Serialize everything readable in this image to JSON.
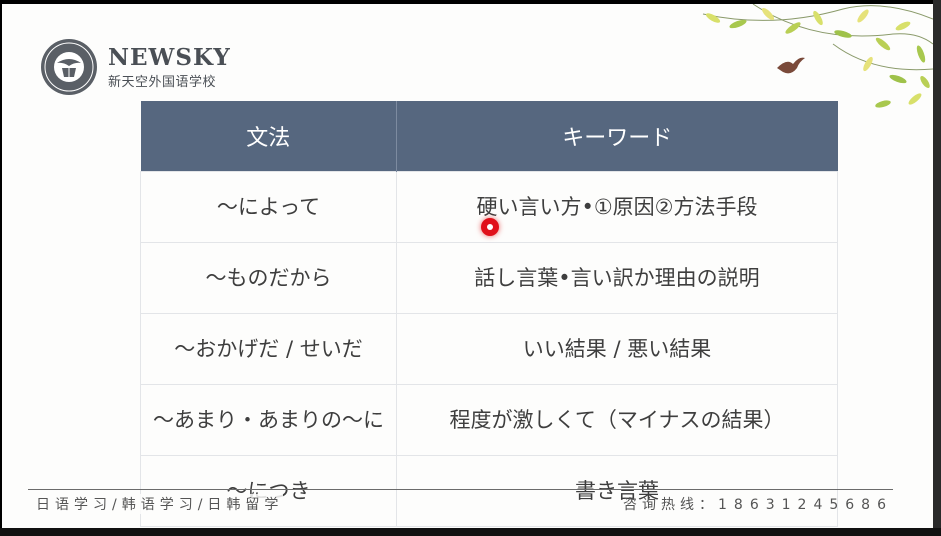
{
  "brand": {
    "name": "NEWSKY",
    "subtitle": "新天空外国语学校"
  },
  "table": {
    "headers": [
      "文法",
      "キーワード"
    ],
    "rows": [
      {
        "grammar": "～によって",
        "keyword": "硬い言い方•①原因②方法手段"
      },
      {
        "grammar": "～ものだから",
        "keyword": "話し言葉•言い訳か理由の説明"
      },
      {
        "grammar": "～おかげだ / せいだ",
        "keyword": "いい結果 / 悪い結果"
      },
      {
        "grammar": "～あまり・あまりの～に",
        "keyword": "程度が激しくて（マイナスの結果）"
      },
      {
        "grammar": "～につき",
        "keyword": "書き言葉"
      }
    ]
  },
  "footer": {
    "left": "日语学习/韩语学习/日韩留学",
    "hotline_label": "咨询热线：",
    "hotline_number": "18631245686"
  },
  "colors": {
    "header_bg": "#56677f",
    "cursor": "#e0101a",
    "text": "#3e3e3e"
  }
}
